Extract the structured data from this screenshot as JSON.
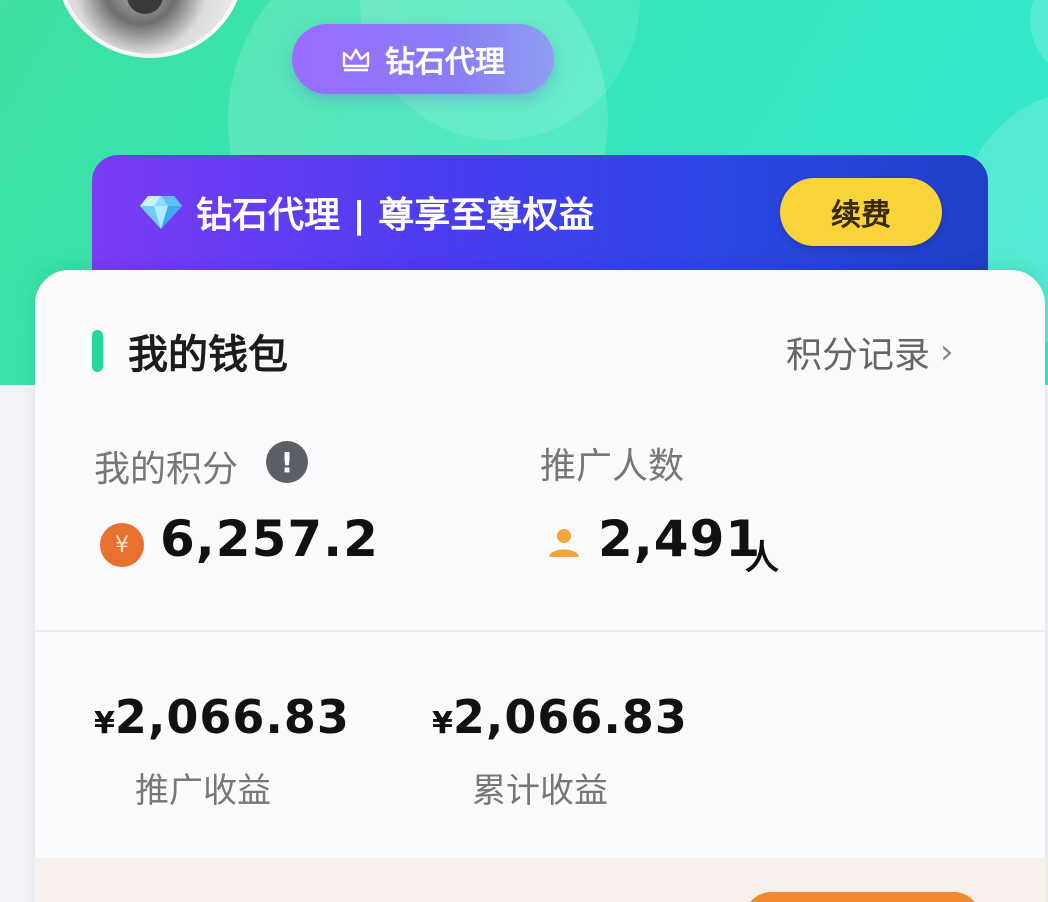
{
  "header": {
    "level_badge": "钻石代理"
  },
  "vip_banner": {
    "title": "钻石代理 | 尊享至尊权益",
    "renew_label": "续费"
  },
  "wallet": {
    "title": "我的钱包",
    "record_link": "积分记录",
    "points": {
      "label": "我的积分",
      "value": "6,257.2",
      "coin_symbol": "¥"
    },
    "referrals": {
      "label": "推广人数",
      "value": "2,491",
      "unit": "人"
    },
    "earnings": [
      {
        "currency": "¥",
        "amount": "2,066.83",
        "label": "推广收益"
      },
      {
        "currency": "¥",
        "amount": "2,066.83",
        "label": "累计收益"
      }
    ]
  },
  "colors": {
    "hero_green": "#33e6b8",
    "accent_green": "#26d69a",
    "renew_yellow": "#f8d33a",
    "coin_orange": "#e8712f",
    "banner_purple": "#7a3cf5",
    "banner_blue": "#1e3fc6"
  },
  "icons": {
    "level": "crown-icon",
    "banner": "diamond-icon",
    "points": "coin-icon",
    "info": "info-icon",
    "referrals": "person-icon",
    "record": "chevron-right-icon"
  }
}
